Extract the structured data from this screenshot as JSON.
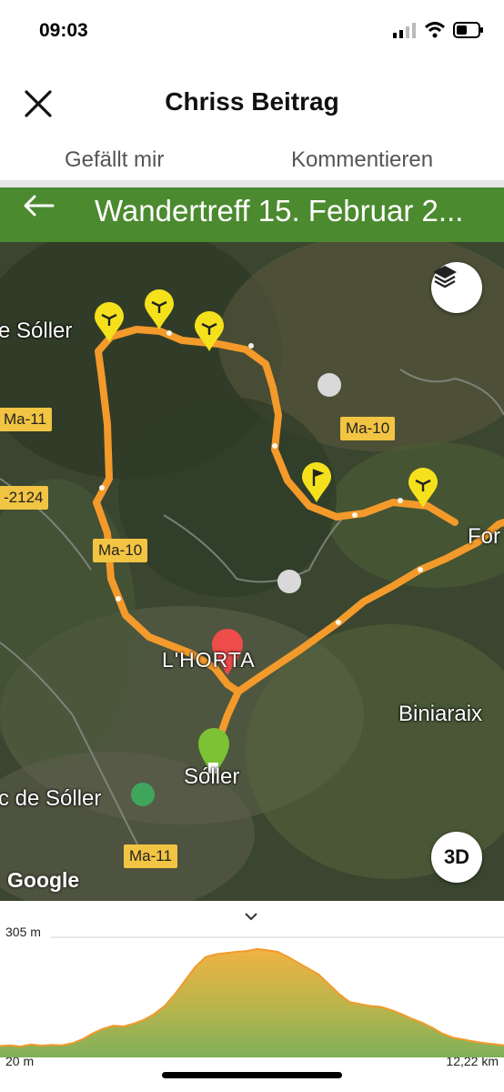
{
  "status_bar": {
    "time": "09:03"
  },
  "header": {
    "title": "Chriss Beitrag"
  },
  "tabs": [
    {
      "label": "Gefällt mir"
    },
    {
      "label": "Kommentieren"
    }
  ],
  "tour": {
    "title": "Wandertreff 15. Februar 2..."
  },
  "map": {
    "place_labels": [
      "e Sóller",
      "L'HORTA",
      "Biniaraix",
      "Sóller",
      "c de Sóller",
      "For"
    ],
    "road_labels": [
      "Ma-11",
      "-2124",
      "Ma-10",
      "Ma-10",
      "Ma-11"
    ],
    "three_d_label": "3D",
    "attribution": "Google",
    "route_color": "#f39a2b",
    "start_marker_color": "#7cc234",
    "end_marker_color": "#ee4b4b",
    "waypoint_color": "#f4e11c"
  },
  "elevation": {
    "max_label": "305 m",
    "min_label": "20 m",
    "distance_label": "12,22 km",
    "max_m": 305,
    "min_m": 20,
    "distance_km": 12.22,
    "profile_m": [
      28,
      30,
      27,
      32,
      29,
      31,
      30,
      35,
      45,
      60,
      72,
      80,
      78,
      85,
      95,
      110,
      130,
      160,
      195,
      230,
      255,
      262,
      265,
      268,
      270,
      275,
      272,
      268,
      255,
      240,
      225,
      210,
      185,
      160,
      140,
      135,
      130,
      128,
      120,
      110,
      98,
      88,
      75,
      60,
      50,
      45,
      40,
      36,
      33,
      30
    ]
  }
}
